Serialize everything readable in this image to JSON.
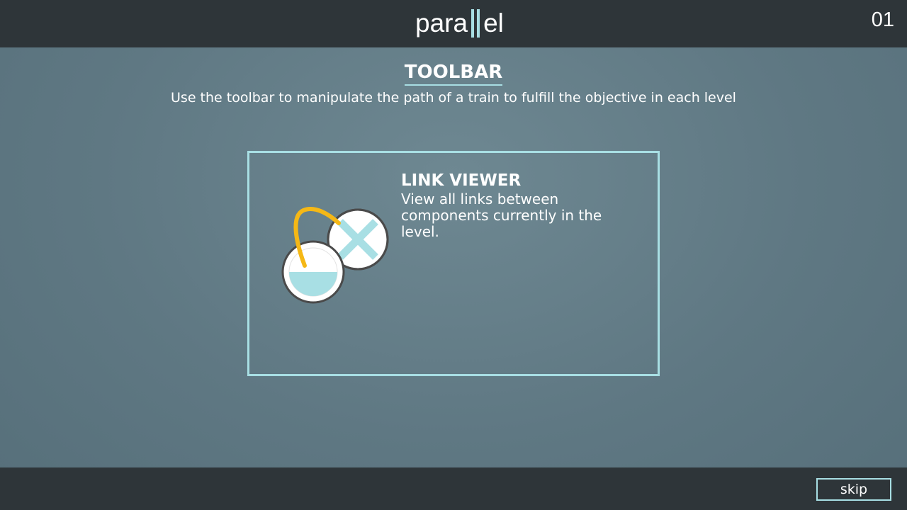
{
  "header": {
    "logo_left": "para",
    "logo_right": "el",
    "level_number": "01"
  },
  "tutorial": {
    "title": "TOOLBAR",
    "subtitle": "Use the toolbar to manipulate the path of a train to fulfill the objective in each level"
  },
  "tool": {
    "name": "LINK VIEWER",
    "description": "View all links between components currently in the level.",
    "icon": "link-viewer-icon"
  },
  "footer": {
    "skip_label": "skip"
  },
  "colors": {
    "accent": "#a8dfe4",
    "link_wire": "#f5b816",
    "bar_background": "#2e3539",
    "background": "#5f7a84"
  }
}
